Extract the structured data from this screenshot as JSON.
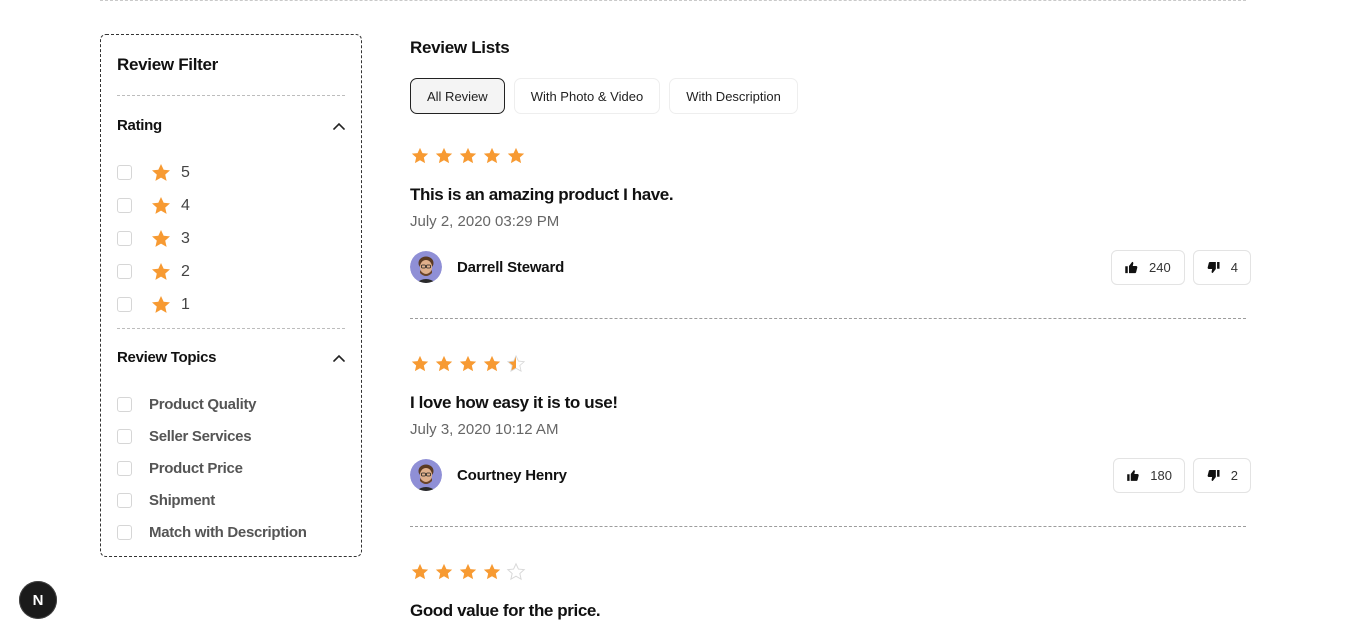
{
  "filter": {
    "title": "Review Filter",
    "rating": {
      "label": "Rating",
      "expanded": true,
      "options": [
        "5",
        "4",
        "3",
        "2",
        "1"
      ]
    },
    "topics": {
      "label": "Review Topics",
      "expanded": true,
      "options": [
        "Product Quality",
        "Seller Services",
        "Product Price",
        "Shipment",
        "Match with Description"
      ]
    }
  },
  "main": {
    "title": "Review Lists",
    "tabs": [
      {
        "label": "All Review",
        "active": true
      },
      {
        "label": "With Photo & Video",
        "active": false
      },
      {
        "label": "With Description",
        "active": false
      }
    ],
    "reviews": [
      {
        "rating": 5,
        "title": "This is an amazing product I have.",
        "date": "July 2, 2020 03:29 PM",
        "author": "Darrell Steward",
        "likes": "240",
        "dislikes": "4"
      },
      {
        "rating": 4.5,
        "title": "I love how easy it is to use!",
        "date": "July 3, 2020 10:12 AM",
        "author": "Courtney Henry",
        "likes": "180",
        "dislikes": "2"
      },
      {
        "rating": 4,
        "title": "Good value for the price.",
        "date": "",
        "author": "",
        "likes": "",
        "dislikes": ""
      }
    ]
  },
  "badge": {
    "letter": "N"
  },
  "colors": {
    "star": "#F79A32",
    "star_empty": "#D8D8D8",
    "text": "#111111",
    "muted": "#666666"
  }
}
